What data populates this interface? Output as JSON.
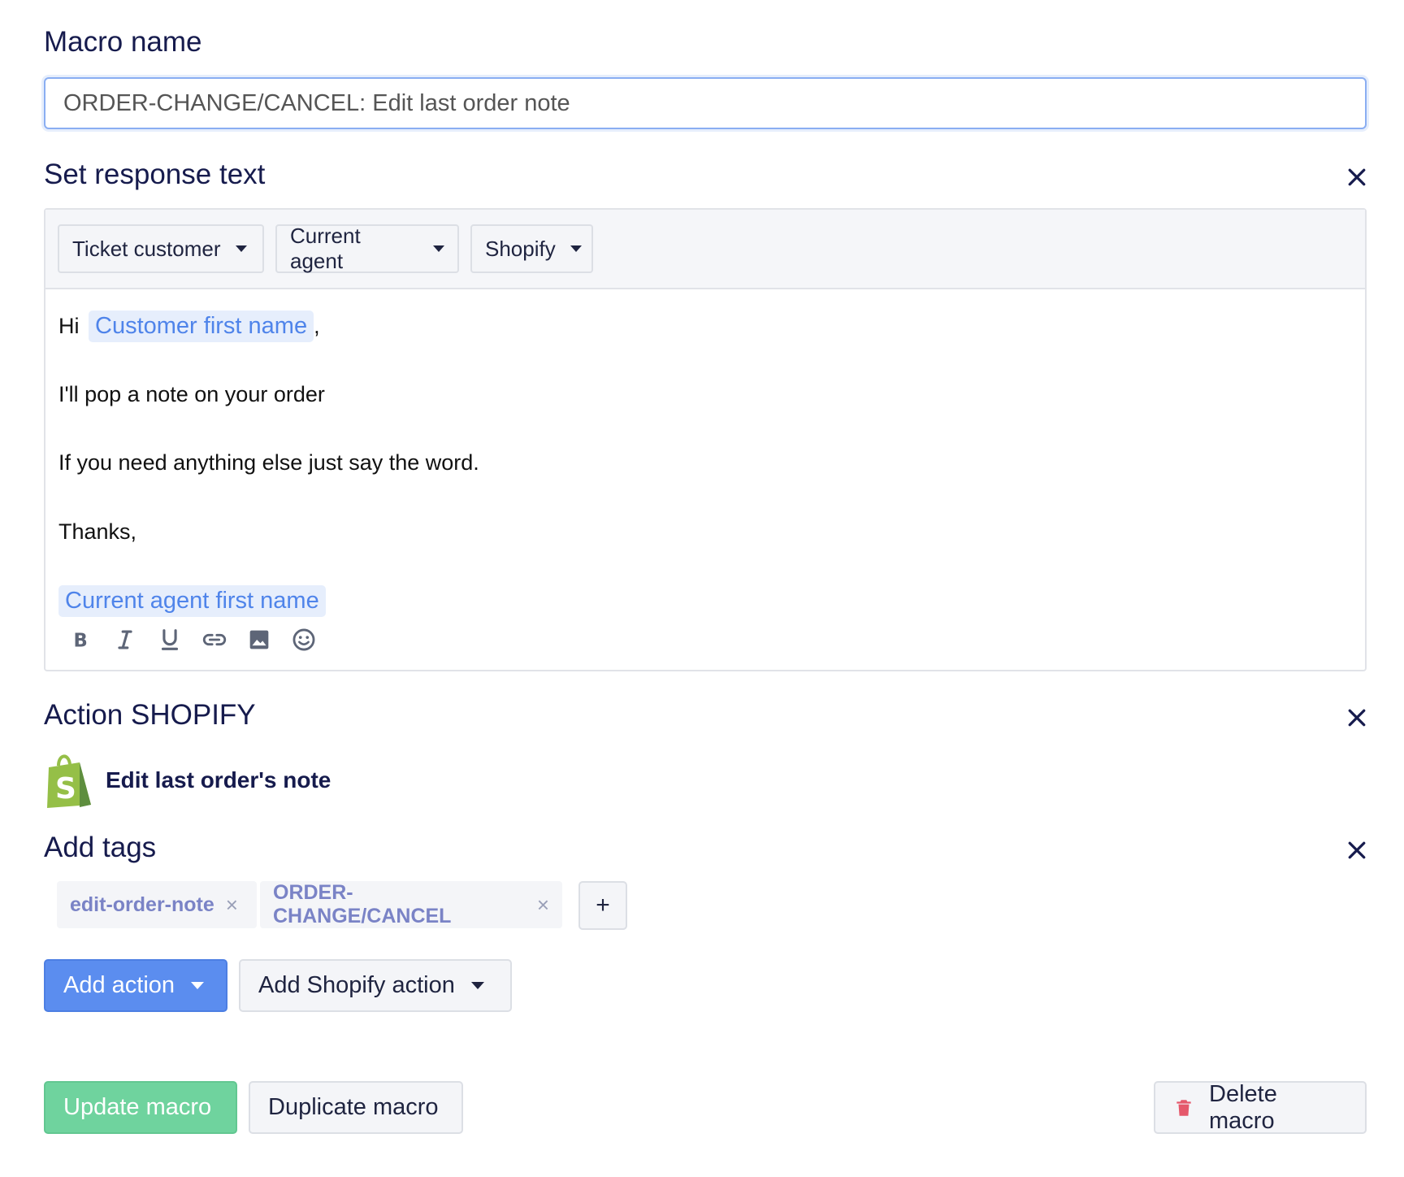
{
  "macro_name": {
    "label": "Macro name",
    "value": "ORDER-CHANGE/CANCEL: Edit last order note"
  },
  "response": {
    "title": "Set response text",
    "variable_buttons": [
      "Ticket customer",
      "Current agent",
      "Shopify"
    ],
    "greeting": "Hi",
    "customer_var": "Customer first name",
    "comma": ",",
    "line1": "I'll pop a note on your order",
    "line2": "If you need anything else just say the word.",
    "line3": "Thanks,",
    "agent_var": "Current agent first name",
    "format_icons": [
      "bold-icon",
      "italic-icon",
      "underline-icon",
      "link-icon",
      "image-icon",
      "emoji-icon"
    ]
  },
  "shopify_action": {
    "title": "Action SHOPIFY",
    "item_label": "Edit last order's note",
    "icon": "shopify-bag-icon"
  },
  "tags": {
    "title": "Add tags",
    "items": [
      "edit-order-note",
      "ORDER-CHANGE/CANCEL"
    ],
    "remove_glyph": "×",
    "add_glyph": "+"
  },
  "actions": {
    "add_action": "Add action",
    "add_shopify_action": "Add Shopify action"
  },
  "footer": {
    "update": "Update macro",
    "duplicate": "Duplicate macro",
    "delete": "Delete macro"
  },
  "colors": {
    "title": "#161b4d",
    "primary": "#5b8def",
    "success": "#6fd39e",
    "danger": "#e5586b",
    "variable": "#4f84ea"
  }
}
